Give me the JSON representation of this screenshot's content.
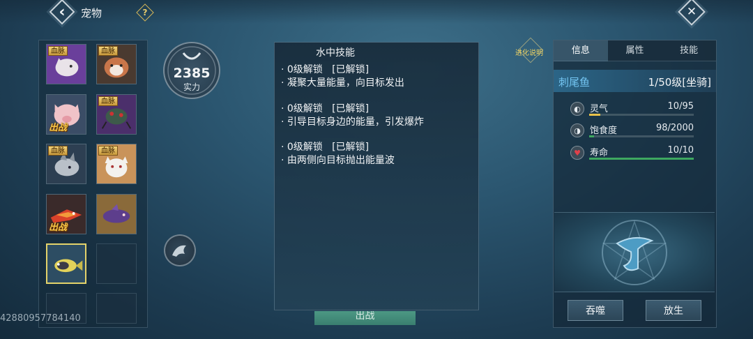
{
  "header": {
    "title": "宠物",
    "help_symbol": "?",
    "back_symbol": "‹",
    "close_symbol": "✕"
  },
  "pets": [
    {
      "name": "white-wolf",
      "tag": "血脉",
      "active": ""
    },
    {
      "name": "red-panda",
      "tag": "血脉",
      "active": ""
    },
    {
      "name": "pig",
      "tag": "",
      "active": "出战"
    },
    {
      "name": "beetle",
      "tag": "血脉",
      "active": ""
    },
    {
      "name": "grey-dragon",
      "tag": "血脉",
      "active": ""
    },
    {
      "name": "white-fox",
      "tag": "血脉",
      "active": ""
    },
    {
      "name": "fire-bird",
      "tag": "",
      "active": "出战"
    },
    {
      "name": "purple-shark",
      "tag": "",
      "active": ""
    },
    {
      "name": "yellow-fish",
      "tag": "",
      "active": ""
    }
  ],
  "user_id": "42880957784140",
  "power": {
    "value": "2385",
    "label": "实力"
  },
  "skills": {
    "title": "水中技能",
    "lines": [
      "· 0级解锁   [已解锁]",
      "· 凝聚大量能量，向目标发出",
      "· 0级解锁   [已解锁]",
      "· 引导目标身边的能量，引发爆炸",
      "· 0级解锁   [已解锁]",
      "· 由两侧向目标抛出能量波"
    ]
  },
  "deploy_button": "出战",
  "evolution_link": "进化说明",
  "info": {
    "tabs": [
      "信息",
      "属性",
      "技能"
    ],
    "pet_name": "刺尾鱼",
    "level": "1/50级[坐骑]",
    "stats": [
      {
        "label": "灵气",
        "value": "10/95",
        "fraction": 0.105,
        "color": "#e8c24a",
        "icon": "spirit-icon"
      },
      {
        "label": "饱食度",
        "value": "98/2000",
        "fraction": 0.049,
        "color": "#3ea860",
        "icon": "food-icon"
      },
      {
        "label": "寿命",
        "value": "10/10",
        "fraction": 1.0,
        "color": "#3ea860",
        "icon": "heart-icon"
      }
    ],
    "buttons": {
      "devour": "吞噬",
      "release": "放生"
    }
  }
}
